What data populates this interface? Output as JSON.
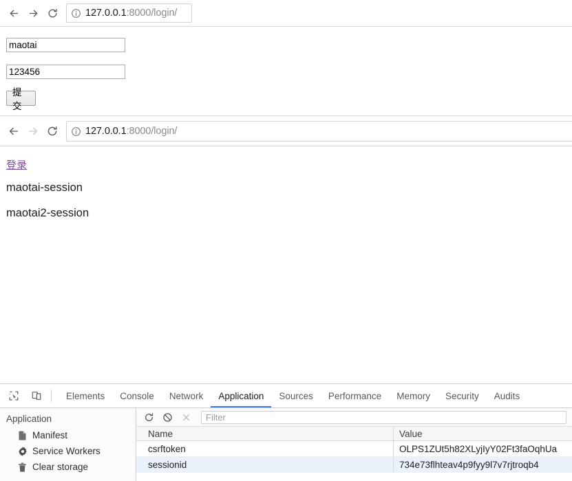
{
  "browser1": {
    "back_icon": "back-arrow-icon",
    "forward_icon": "forward-arrow-icon",
    "reload_icon": "reload-icon",
    "info_icon": "page-info-icon",
    "url_host": "127.0.0.1",
    "url_rest": ":8000/login/"
  },
  "browser2": {
    "back_icon": "back-arrow-icon",
    "forward_icon": "forward-arrow-icon",
    "reload_icon": "reload-icon",
    "info_icon": "page-info-icon",
    "url_host": "127.0.0.1",
    "url_rest": ":8000/login/"
  },
  "login_form": {
    "username_value": "maotai",
    "username_placeholder": "",
    "password_value": "123456",
    "password_placeholder": "",
    "submit_label": "提交"
  },
  "result_page": {
    "login_link": "登录",
    "lines": [
      "maotai-session",
      "maotai2-session"
    ]
  },
  "devtools": {
    "inspect_icon": "inspect-element-icon",
    "device_icon": "device-toolbar-icon",
    "tabs": [
      {
        "label": "Elements",
        "active": false
      },
      {
        "label": "Console",
        "active": false
      },
      {
        "label": "Network",
        "active": false
      },
      {
        "label": "Application",
        "active": true
      },
      {
        "label": "Sources",
        "active": false
      },
      {
        "label": "Performance",
        "active": false
      },
      {
        "label": "Memory",
        "active": false
      },
      {
        "label": "Security",
        "active": false
      },
      {
        "label": "Audits",
        "active": false
      }
    ],
    "sidebar": {
      "section_title": "Application",
      "items": [
        {
          "label": "Manifest",
          "icon": "manifest-document-icon"
        },
        {
          "label": "Service Workers",
          "icon": "gear-icon"
        },
        {
          "label": "Clear storage",
          "icon": "trash-icon"
        }
      ]
    },
    "toolbar": {
      "refresh_icon": "refresh-icon",
      "clear_icon": "clear-all-cookies-icon",
      "delete_icon": "delete-selected-icon",
      "filter_placeholder": "Filter",
      "filter_value": ""
    },
    "cookies_table": {
      "columns": [
        "Name",
        "Value"
      ],
      "rows": [
        {
          "name": "csrftoken",
          "value": "OLPS1ZUt5h82XLyjIyY02Ft3faOqhUa",
          "selected": false
        },
        {
          "name": "sessionid",
          "value": "734e73flhteav4p9fyy9l7v7rjtroqb4",
          "selected": true
        }
      ]
    }
  },
  "colors": {
    "accent": "#3b7de0",
    "link": "#7a4ca8",
    "selected_row": "#eaf1fb"
  }
}
